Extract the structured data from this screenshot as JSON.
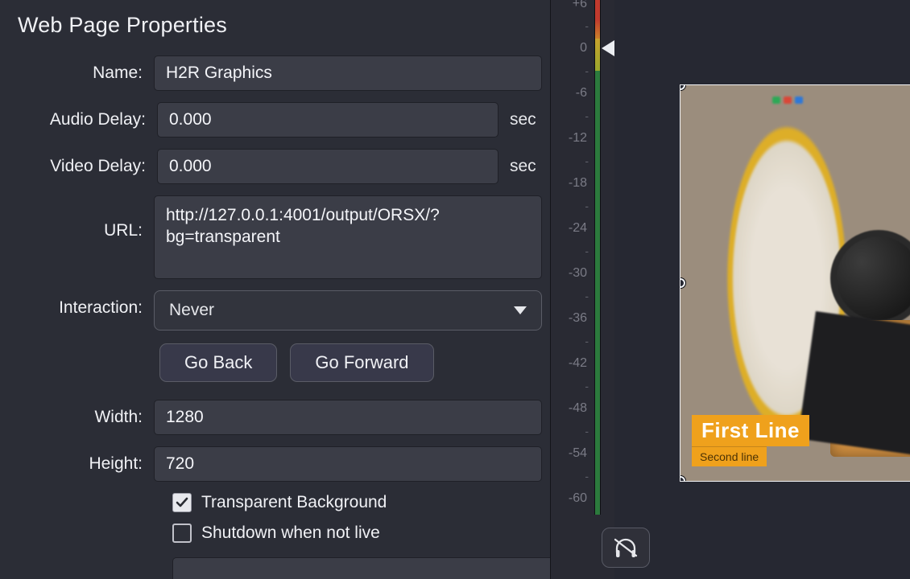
{
  "panel": {
    "title": "Web Page Properties",
    "fields": {
      "name_label": "Name:",
      "name_value": "H2R Graphics",
      "audio_delay_label": "Audio Delay:",
      "audio_delay_value": "0.000",
      "video_delay_label": "Video Delay:",
      "video_delay_value": "0.000",
      "delay_unit": "sec",
      "url_label": "URL:",
      "url_value": "http://127.0.0.1:4001/output/ORSX/?bg=transparent",
      "interaction_label": "Interaction:",
      "interaction_selected": "Never",
      "width_label": "Width:",
      "width_value": "1280",
      "height_label": "Height:",
      "height_value": "720"
    },
    "buttons": {
      "go_back": "Go Back",
      "go_forward": "Go Forward"
    },
    "checkboxes": {
      "transparent_bg": {
        "label": "Transparent Background",
        "checked": true
      },
      "shutdown": {
        "label": "Shutdown when not live",
        "checked": false
      }
    }
  },
  "scale": {
    "marker_value": 0,
    "labels": [
      "+6",
      "0",
      "-6",
      "-12",
      "-18",
      "-24",
      "-30",
      "-36",
      "-42",
      "-48",
      "-54",
      "-60"
    ]
  },
  "preview": {
    "lower_third": {
      "line1": "First Line",
      "line2": "Second line"
    }
  },
  "colors": {
    "accent_orange": "#efa11c",
    "panel_bg": "#2b2d36",
    "input_bg": "#3b3d47"
  }
}
